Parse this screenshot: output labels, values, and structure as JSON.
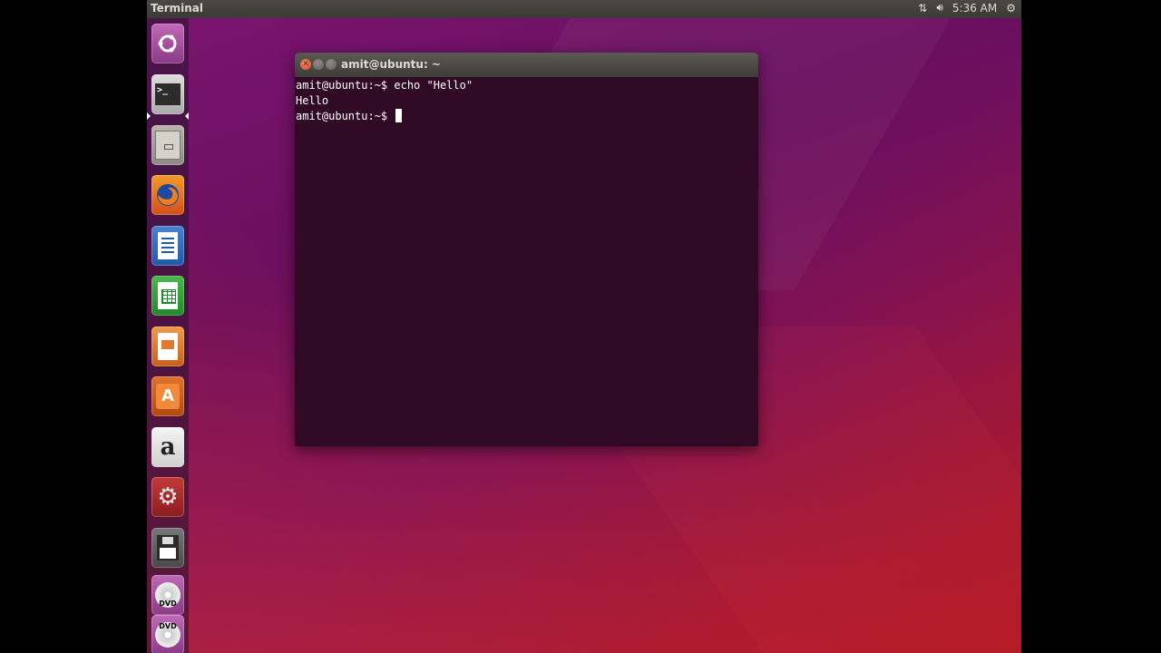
{
  "topbar": {
    "app_title": "Terminal",
    "clock": "5:36 AM",
    "icons": [
      "network-icon",
      "volume-icon",
      "settings-gear-icon"
    ]
  },
  "launcher": {
    "items": [
      {
        "name": "Search your computer",
        "icon": "ubuntu-dash-icon"
      },
      {
        "name": "Terminal",
        "icon": "terminal-icon",
        "active": true
      },
      {
        "name": "Files",
        "icon": "files-icon"
      },
      {
        "name": "Firefox Web Browser",
        "icon": "firefox-icon"
      },
      {
        "name": "LibreOffice Writer",
        "icon": "writer-icon"
      },
      {
        "name": "LibreOffice Calc",
        "icon": "calc-icon"
      },
      {
        "name": "LibreOffice Impress",
        "icon": "impress-icon"
      },
      {
        "name": "Ubuntu Software",
        "icon": "software-center-icon"
      },
      {
        "name": "Amazon",
        "icon": "amazon-icon"
      },
      {
        "name": "System Settings",
        "icon": "system-settings-icon"
      },
      {
        "name": "Floppy",
        "icon": "floppy-icon"
      },
      {
        "name": "DVD",
        "icon": "dvd-icon"
      },
      {
        "name": "DVD",
        "icon": "dvd-icon"
      }
    ]
  },
  "terminal": {
    "window_title": "amit@ubuntu: ~",
    "lines": [
      "amit@ubuntu:~$ echo \"Hello\"",
      "Hello",
      "amit@ubuntu:~$ "
    ]
  }
}
